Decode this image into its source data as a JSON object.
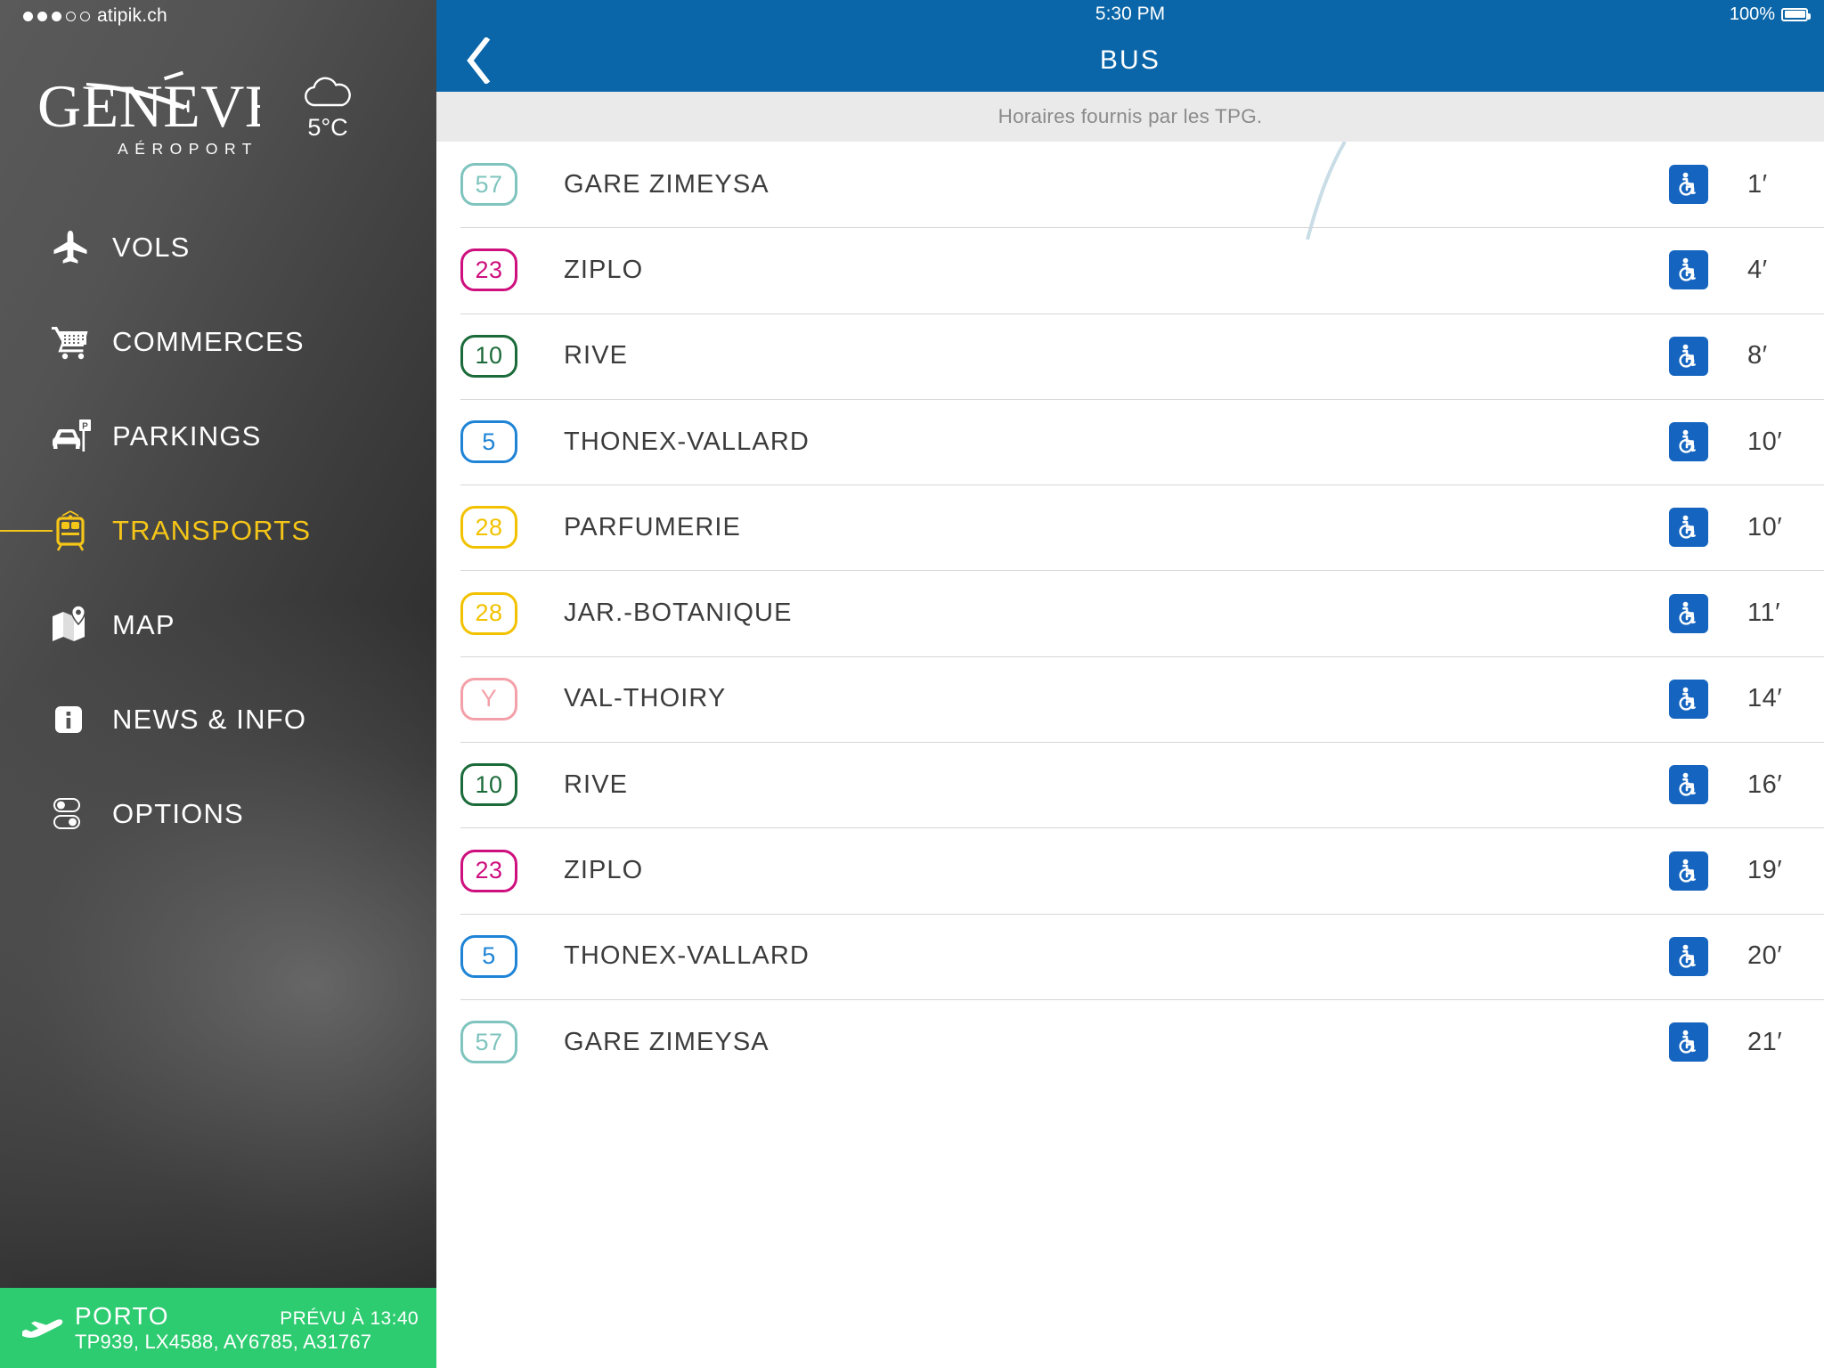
{
  "sidebar": {
    "carrier_status": {
      "signal_filled": 3,
      "signal_total": 5,
      "carrier": "atipik.ch"
    },
    "logo": {
      "wordmark": "GENÈVE",
      "subtitle": "AÉROPORT"
    },
    "weather": {
      "icon": "cloud-icon",
      "temperature": "5°C"
    },
    "items": [
      {
        "label": "VOLS",
        "icon": "plane-icon",
        "active": false
      },
      {
        "label": "COMMERCES",
        "icon": "shopping-cart-icon",
        "active": false
      },
      {
        "label": "PARKINGS",
        "icon": "car-parking-icon",
        "active": false
      },
      {
        "label": "TRANSPORTS",
        "icon": "tram-icon",
        "active": true
      },
      {
        "label": "MAP",
        "icon": "map-pin-icon",
        "active": false
      },
      {
        "label": "NEWS & INFO",
        "icon": "info-icon",
        "active": false
      },
      {
        "label": "OPTIONS",
        "icon": "toggles-icon",
        "active": false
      }
    ],
    "active_color": "#F5C518",
    "flight_bar": {
      "icon": "departing-plane-icon",
      "destination": "PORTO",
      "eta": "PRÉVU À 13:40",
      "flight_codes": "TP939, LX4588, AY6785, A31767",
      "color": "#2ECC71"
    }
  },
  "main": {
    "status_bar": {
      "time": "5:30 PM",
      "battery_percent": "100%",
      "battery_icon": "battery-full-icon"
    },
    "nav": {
      "back_icon": "chevron-left-icon",
      "title": "BUS",
      "color": "#0A66A8"
    },
    "subtitle": "Horaires fournis par les TPG.",
    "accessibility_icon": "wheelchair-icon",
    "rows": [
      {
        "line": "57",
        "color": "#7FC4BE",
        "destination": "GARE ZIMEYSA",
        "accessible": true,
        "time": "1′"
      },
      {
        "line": "23",
        "color": "#CE0F7E",
        "destination": "ZIPLO",
        "accessible": true,
        "time": "4′"
      },
      {
        "line": "10",
        "color": "#1B6B3A",
        "destination": "RIVE",
        "accessible": true,
        "time": "8′"
      },
      {
        "line": "5",
        "color": "#1F84D6",
        "destination": "THONEX-VALLARD",
        "accessible": true,
        "time": "10′"
      },
      {
        "line": "28",
        "color": "#F2C200",
        "destination": "PARFUMERIE",
        "accessible": true,
        "time": "10′"
      },
      {
        "line": "28",
        "color": "#F2C200",
        "destination": "JAR.-BOTANIQUE",
        "accessible": true,
        "time": "11′"
      },
      {
        "line": "Y",
        "color": "#F4A0A8",
        "destination": "VAL-THOIRY",
        "accessible": true,
        "time": "14′"
      },
      {
        "line": "10",
        "color": "#1B6B3A",
        "destination": "RIVE",
        "accessible": true,
        "time": "16′"
      },
      {
        "line": "23",
        "color": "#CE0F7E",
        "destination": "ZIPLO",
        "accessible": true,
        "time": "19′"
      },
      {
        "line": "5",
        "color": "#1F84D6",
        "destination": "THONEX-VALLARD",
        "accessible": true,
        "time": "20′"
      },
      {
        "line": "57",
        "color": "#7FC4BE",
        "destination": "GARE ZIMEYSA",
        "accessible": true,
        "time": "21′"
      }
    ]
  }
}
